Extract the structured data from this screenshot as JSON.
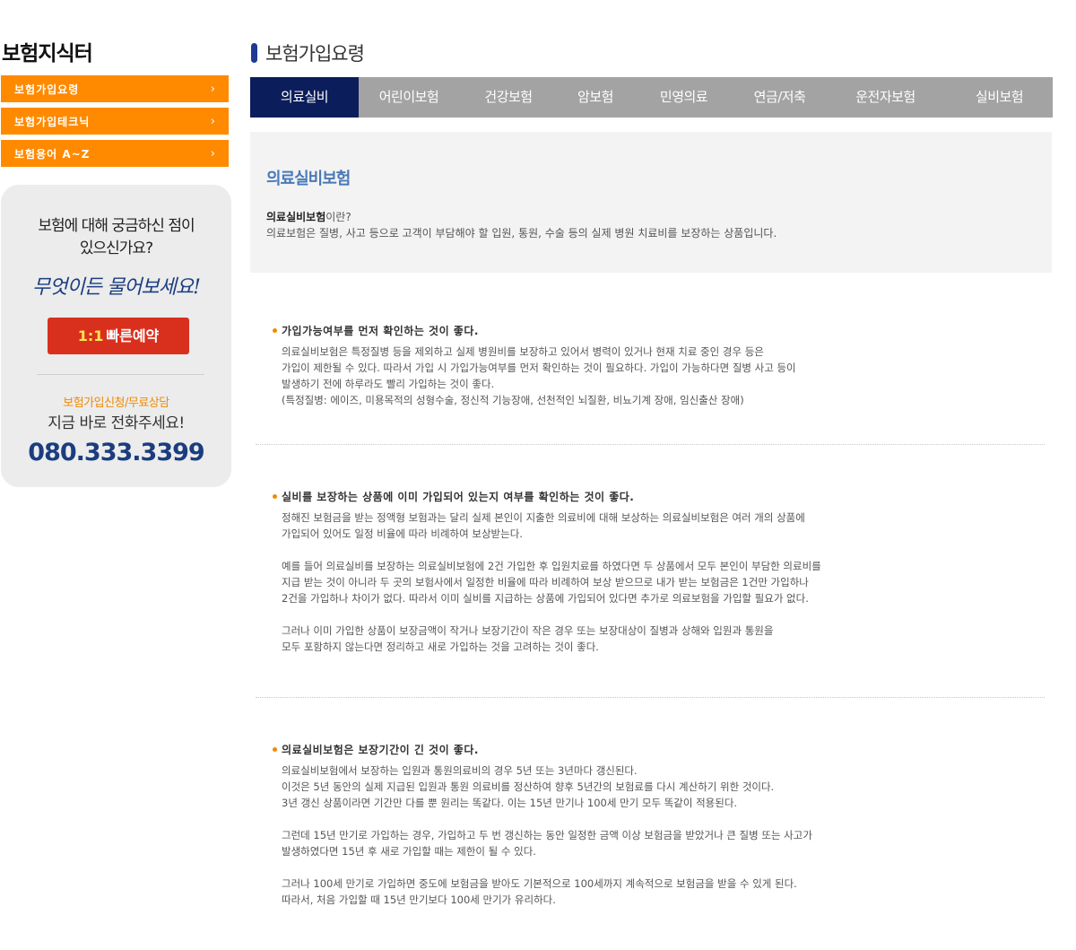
{
  "sidebar": {
    "title": "보험지식터",
    "menu": [
      {
        "label": "보험가입요령"
      },
      {
        "label": "보험가입테크닉"
      },
      {
        "label": "보험용어 A~Z"
      }
    ],
    "chevron": "›",
    "qa": {
      "question": "보험에 대해 궁금하신 점이\n있으신가요?",
      "script": "무엇이든 물어보세요!",
      "button_ratio": "1:1",
      "button_label": "빠른예약",
      "apply": "보험가입신청/무료상담",
      "call": "지금 바로 전화주세요!",
      "phone": "080.333.3399"
    }
  },
  "main": {
    "heading": "보험가입요령",
    "tabs": [
      {
        "label": "의료실비",
        "active": true
      },
      {
        "label": "어린이보험"
      },
      {
        "label": "건강보험"
      },
      {
        "label": "암보험"
      },
      {
        "label": "민영의료"
      },
      {
        "label": "연금/저축"
      },
      {
        "label": "운전자보험"
      },
      {
        "label": "실비보험"
      }
    ],
    "intro": {
      "title": "의료실비보험",
      "q_bold": "의료실비보험",
      "q_rest": "이란?",
      "desc": "의료보험은 질병, 사고 등으로 고객이 부담해야 할 입원, 통원, 수술 등의 실제 병원 치료비를 보장하는 상품입니다."
    },
    "sections": [
      {
        "title": "가입가능여부를 먼저 확인하는 것이 좋다.",
        "paragraphs": [
          "의료실비보험은 특정질병 등을 제외하고 실제 병원비를 보장하고 있어서 병력이 있거나 현재 치료 중인 경우 등은\n가입이 제한될 수 있다. 따라서 가입 시 가입가능여부를 먼저 확인하는 것이 필요하다. 가입이 가능하다면 질병 사고 등이\n발생하기 전에 하루라도 빨리 가입하는 것이 좋다.\n(특정질병: 에이즈, 미용목적의 성형수술, 정신적 기능장애, 선천적인 뇌질환, 비뇨기계 장애, 임신출산 장애)"
        ]
      },
      {
        "title": "실비를 보장하는 상품에 이미 가입되어 있는지 여부를 확인하는 것이 좋다.",
        "paragraphs": [
          "정해진 보험금을 받는 정액형 보험과는 달리 실제 본인이 지출한 의료비에 대해 보상하는 의료실비보험은 여러 개의 상품에\n가입되어 있어도 일정 비율에 따라 비례하여 보상받는다.",
          "예를 들어 의료실비를 보장하는 의료실비보험에 2건 가입한 후 입원치료를 하였다면 두 상품에서 모두 본인이 부담한 의료비를\n지급 받는 것이 아니라 두 곳의 보험사에서 일정한 비율에 따라 비례하여 보상 받으므로 내가 받는 보험금은 1건만 가입하나\n2건을 가입하나 차이가 없다. 따라서 이미 실비를 지급하는 상품에 가입되어 있다면 추가로 의료보험을 가입할 필요가 없다.",
          "그러나 이미 가입한 상품이 보장금액이 작거나 보장기간이 작은 경우 또는 보장대상이 질병과 상해와 입원과 통원을\n모두 포함하지 않는다면 정리하고 새로 가입하는 것을 고려하는 것이 좋다."
        ]
      },
      {
        "title": "의료실비보험은 보장기간이 긴 것이 좋다.",
        "paragraphs": [
          "의료실비보험에서 보장하는 입원과 통원의료비의 경우 5년 또는 3년마다 갱신된다.\n이것은 5년 동안의 실제 지급된 입원과 통원 의료비를 정산하여 향후 5년간의 보험료를 다시 계산하기 위한 것이다.\n3년 갱신 상품이라면 기간만 다를 뿐 원리는 똑같다. 이는 15년 만기나 100세 만기 모두 똑같이 적용된다.",
          "그런데 15년 만기로 가입하는 경우, 가입하고 두 번 갱신하는 동안 일정한 금액 이상 보험금을 받았거나 큰 질병 또는 사고가\n발생하였다면 15년 후 새로 가입할 때는 제한이 될 수 있다.",
          "그러나 100세 만기로 가입하면 중도에 보험금을 받아도 기본적으로 100세까지 계속적으로 보험금을 받을 수 있게 된다.\n따라서, 처음 가입할 때 15년 만기보다 100세 만기가 유리하다."
        ]
      }
    ]
  },
  "colors": {
    "accent_orange": "#ff8a00",
    "tab_active": "#0b1d5a",
    "tab_bg": "#a3a3a3",
    "brand_blue": "#1b3d80",
    "button_red": "#d9301e"
  }
}
